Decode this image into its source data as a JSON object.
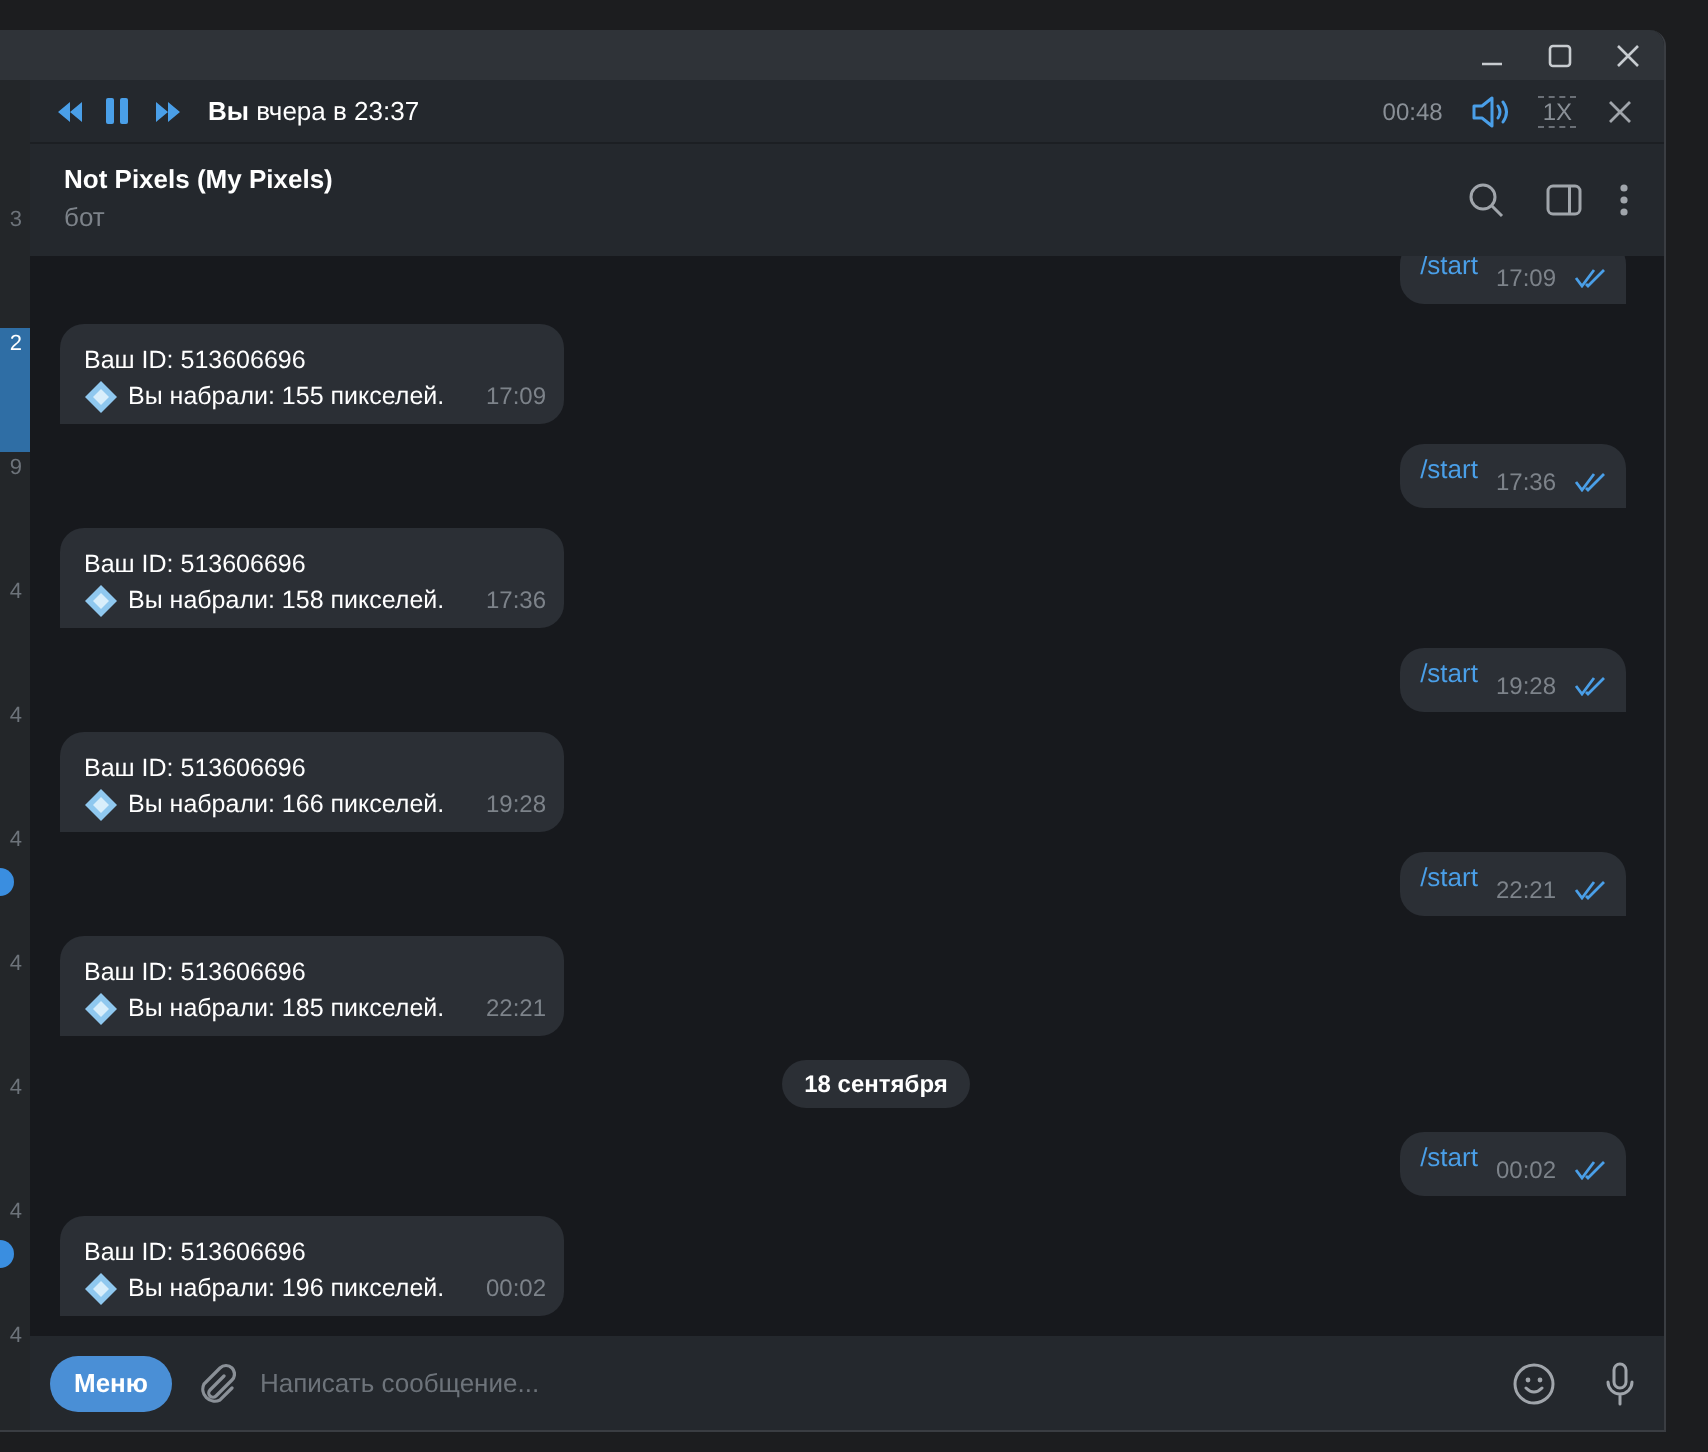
{
  "player": {
    "author": "Вы",
    "when": "вчера в 23:37",
    "time": "00:48",
    "speed": "1X"
  },
  "chat": {
    "title": "Not Pixels (My Pixels)",
    "subtitle": "бот"
  },
  "sidebar_items": [
    {
      "fragment": "3",
      "selected": false,
      "badge": false
    },
    {
      "fragment": "2",
      "selected": true,
      "badge": false
    },
    {
      "fragment": "9",
      "selected": false,
      "badge": false
    },
    {
      "fragment": "4",
      "selected": false,
      "badge": false
    },
    {
      "fragment": "4",
      "selected": false,
      "badge": false
    },
    {
      "fragment": "4",
      "selected": false,
      "badge": true
    },
    {
      "fragment": "4",
      "selected": false,
      "badge": false
    },
    {
      "fragment": "4",
      "selected": false,
      "badge": false
    },
    {
      "fragment": "4",
      "selected": false,
      "badge": true
    },
    {
      "fragment": "4",
      "selected": false,
      "badge": false
    }
  ],
  "messages": [
    {
      "kind": "out",
      "text": "/start",
      "time": "17:09",
      "read": true
    },
    {
      "kind": "in",
      "lines": [
        "Ваш ID: 513606696",
        "Вы набрали: 155 пикселей."
      ],
      "time": "17:09"
    },
    {
      "kind": "out",
      "text": "/start",
      "time": "17:36",
      "read": true
    },
    {
      "kind": "in",
      "lines": [
        "Ваш ID: 513606696",
        "Вы набрали: 158 пикселей."
      ],
      "time": "17:36"
    },
    {
      "kind": "out",
      "text": "/start",
      "time": "19:28",
      "read": true
    },
    {
      "kind": "in",
      "lines": [
        "Ваш ID: 513606696",
        "Вы набрали: 166 пикселей."
      ],
      "time": "19:28"
    },
    {
      "kind": "out",
      "text": "/start",
      "time": "22:21",
      "read": true
    },
    {
      "kind": "in",
      "lines": [
        "Ваш ID: 513606696",
        "Вы набрали: 185 пикселей."
      ],
      "time": "22:21"
    },
    {
      "kind": "date",
      "text": "18 сентября"
    },
    {
      "kind": "out",
      "text": "/start",
      "time": "00:02",
      "read": true
    },
    {
      "kind": "in",
      "lines": [
        "Ваш ID: 513606696",
        "Вы набрали: 196 пикселей."
      ],
      "time": "00:02"
    }
  ],
  "composer": {
    "menu_button": "Меню",
    "placeholder": "Написать сообщение..."
  }
}
